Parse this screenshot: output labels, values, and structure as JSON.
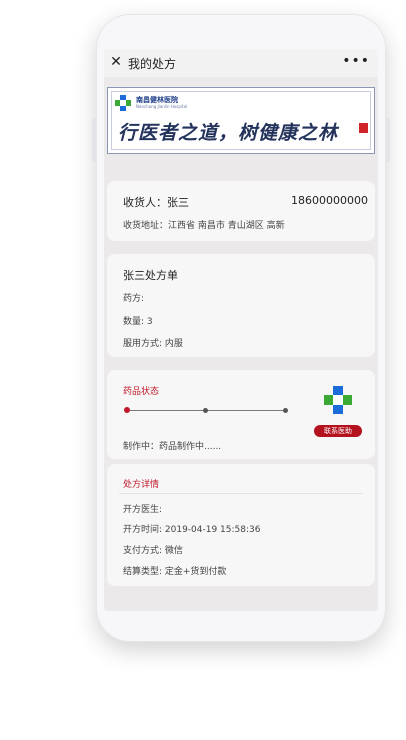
{
  "topbar": {
    "close_icon": "close-icon",
    "title": "我的处方",
    "more_icon": "more-icon"
  },
  "banner": {
    "hospital_name": "南昌健林医院",
    "hospital_name_en": "Nanchang Jianlin Hospital",
    "slogan": "行医者之道，树健康之林"
  },
  "receiver": {
    "label_name": "收货人：张三",
    "phone": "18600000000",
    "address": "收货地址：江西省 南昌市 青山湖区 高新"
  },
  "prescription": {
    "title": "张三处方单",
    "drug": "药方:",
    "quantity": "数量: 3",
    "usage": "服用方式: 内服"
  },
  "status": {
    "title": "药品状态",
    "progress_step": 1,
    "progress_total": 3,
    "note": "制作中：药品制作中......",
    "contact_button": "联系医助"
  },
  "details": {
    "title": "处方详情",
    "doctor": "开方医生:",
    "time": "开方时间:  2019-04-19   15:58:36",
    "payment": "支付方式:  微信",
    "settlement": "结算类型:  定金+货到付款"
  },
  "colors": {
    "accent": "#c0182a",
    "button": "#b4121f",
    "logo_blue": "#1b6bd8",
    "logo_green": "#3aa935"
  }
}
